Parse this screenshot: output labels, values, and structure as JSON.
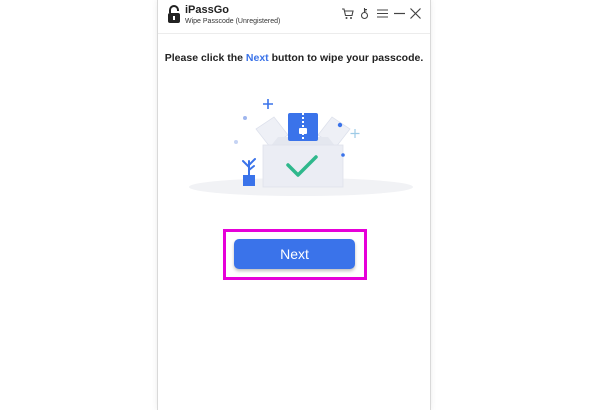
{
  "app": {
    "name": "iPassGo",
    "subtitle": "Wipe Passcode",
    "status": "(Unregistered)"
  },
  "toolbar": {
    "icons": [
      "cart-icon",
      "key-icon",
      "menu-icon",
      "minimize-icon",
      "close-icon"
    ]
  },
  "instruction": {
    "prefix": "Please click the ",
    "highlight": "Next",
    "suffix": " button to wipe your passcode."
  },
  "next_button": {
    "label": "Next"
  },
  "colors": {
    "accent": "#3a73ea",
    "highlight_border": "#e600d9",
    "check": "#2fb88c"
  }
}
